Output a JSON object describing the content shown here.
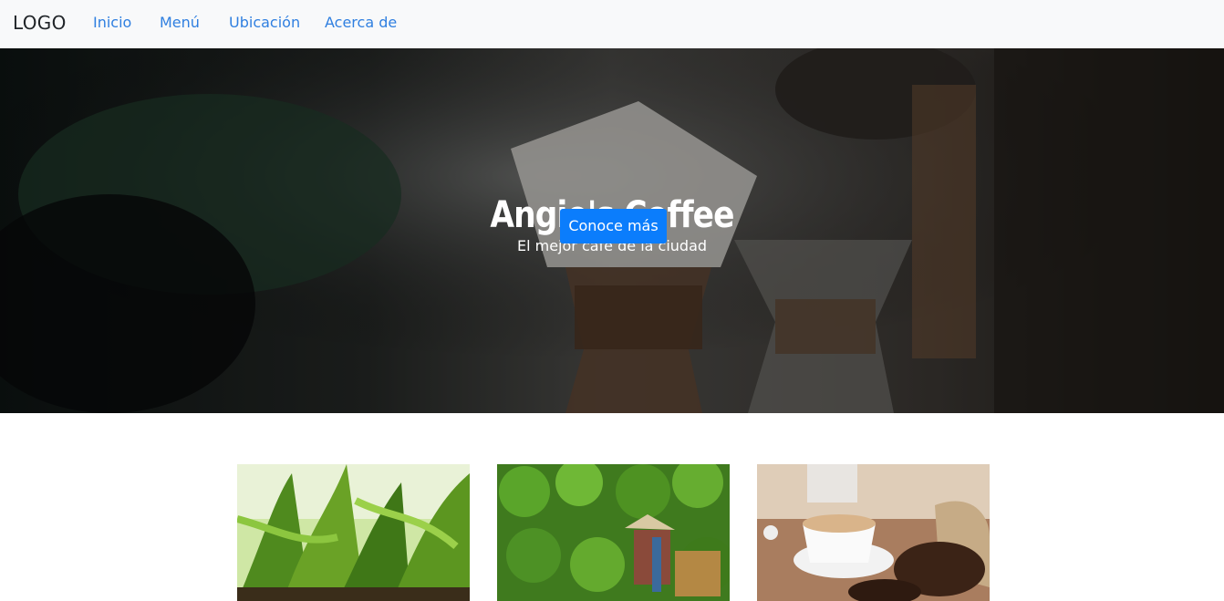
{
  "navbar": {
    "brand": "LOGO",
    "links": [
      {
        "label": "Inicio"
      },
      {
        "label": "Menú"
      },
      {
        "label": "Ubicación"
      },
      {
        "label": "Acerca de"
      }
    ]
  },
  "hero": {
    "title": "Angie's Coffee",
    "subtitle": "El mejor café de la ciudad",
    "button_label": "Conoce más"
  },
  "cards": [
    {
      "image": "corn-plants-photo"
    },
    {
      "image": "coffee-picker-photo"
    },
    {
      "image": "coffee-cup-beans-photo"
    }
  ],
  "colors": {
    "navbar_bg": "#f8f9fa",
    "link": "#2f7fe0",
    "button": "#0b7dfc"
  }
}
